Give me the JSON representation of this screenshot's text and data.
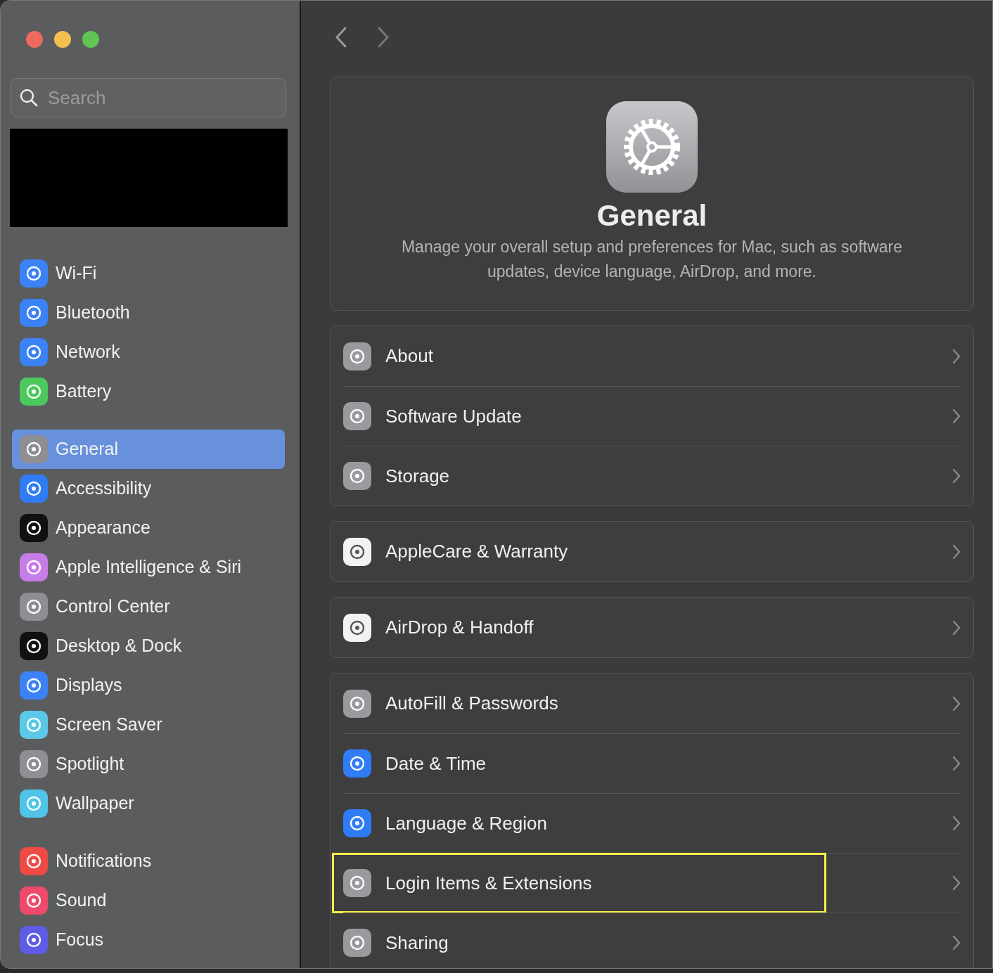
{
  "window": {
    "controls": [
      {
        "color": "#ed6a5e"
      },
      {
        "color": "#f5bf4f"
      },
      {
        "color": "#61c554"
      }
    ]
  },
  "sidebar": {
    "search": {
      "placeholder": "Search"
    },
    "groups": [
      {
        "items": [
          {
            "label": "Wi-Fi",
            "selected": false,
            "color": "#3b82f6"
          },
          {
            "label": "Bluetooth",
            "selected": false,
            "color": "#3b82f6"
          },
          {
            "label": "Network",
            "selected": false,
            "color": "#3b82f6"
          },
          {
            "label": "Battery",
            "selected": false,
            "color": "#4cc95c"
          }
        ]
      },
      {
        "items": [
          {
            "label": "General",
            "selected": true,
            "color": "#8e8e93"
          },
          {
            "label": "Accessibility",
            "selected": false,
            "color": "#2f7cf6"
          },
          {
            "label": "Appearance",
            "selected": false,
            "color": "#111111"
          },
          {
            "label": "Apple Intelligence & Siri",
            "selected": false,
            "color": "#c77de8"
          },
          {
            "label": "Control Center",
            "selected": false,
            "color": "#8e8e93"
          },
          {
            "label": "Desktop & Dock",
            "selected": false,
            "color": "#111111"
          },
          {
            "label": "Displays",
            "selected": false,
            "color": "#3b82f6"
          },
          {
            "label": "Screen Saver",
            "selected": false,
            "color": "#5bc8e8"
          },
          {
            "label": "Spotlight",
            "selected": false,
            "color": "#8e8e93"
          },
          {
            "label": "Wallpaper",
            "selected": false,
            "color": "#4fc3e8"
          }
        ]
      },
      {
        "items": [
          {
            "label": "Notifications",
            "selected": false,
            "color": "#ef4b45"
          },
          {
            "label": "Sound",
            "selected": false,
            "color": "#ee4a6a"
          },
          {
            "label": "Focus",
            "selected": false,
            "color": "#5e5ce6"
          }
        ]
      }
    ]
  },
  "header": {
    "title": "General",
    "description": "Manage your overall setup and preferences for Mac, such as software updates, device language, AirDrop, and more."
  },
  "groups": [
    {
      "rows": [
        {
          "label": "About",
          "color": "#9a9a9e",
          "annotated": false
        },
        {
          "label": "Software Update",
          "color": "#9a9a9e",
          "annotated": false
        },
        {
          "label": "Storage",
          "color": "#9a9a9e",
          "annotated": false
        }
      ]
    },
    {
      "rows": [
        {
          "label": "AppleCare & Warranty",
          "color": "#f2f2f2",
          "annotated": false
        }
      ]
    },
    {
      "rows": [
        {
          "label": "AirDrop & Handoff",
          "color": "#f2f2f2",
          "annotated": false
        }
      ]
    },
    {
      "rows": [
        {
          "label": "AutoFill & Passwords",
          "color": "#9a9a9e",
          "annotated": false
        },
        {
          "label": "Date & Time",
          "color": "#2f7cf6",
          "annotated": false
        },
        {
          "label": "Language & Region",
          "color": "#2f7cf6",
          "annotated": false
        },
        {
          "label": "Login Items & Extensions",
          "color": "#9a9a9e",
          "annotated": true
        },
        {
          "label": "Sharing",
          "color": "#9a9a9e",
          "annotated": false
        }
      ]
    }
  ]
}
